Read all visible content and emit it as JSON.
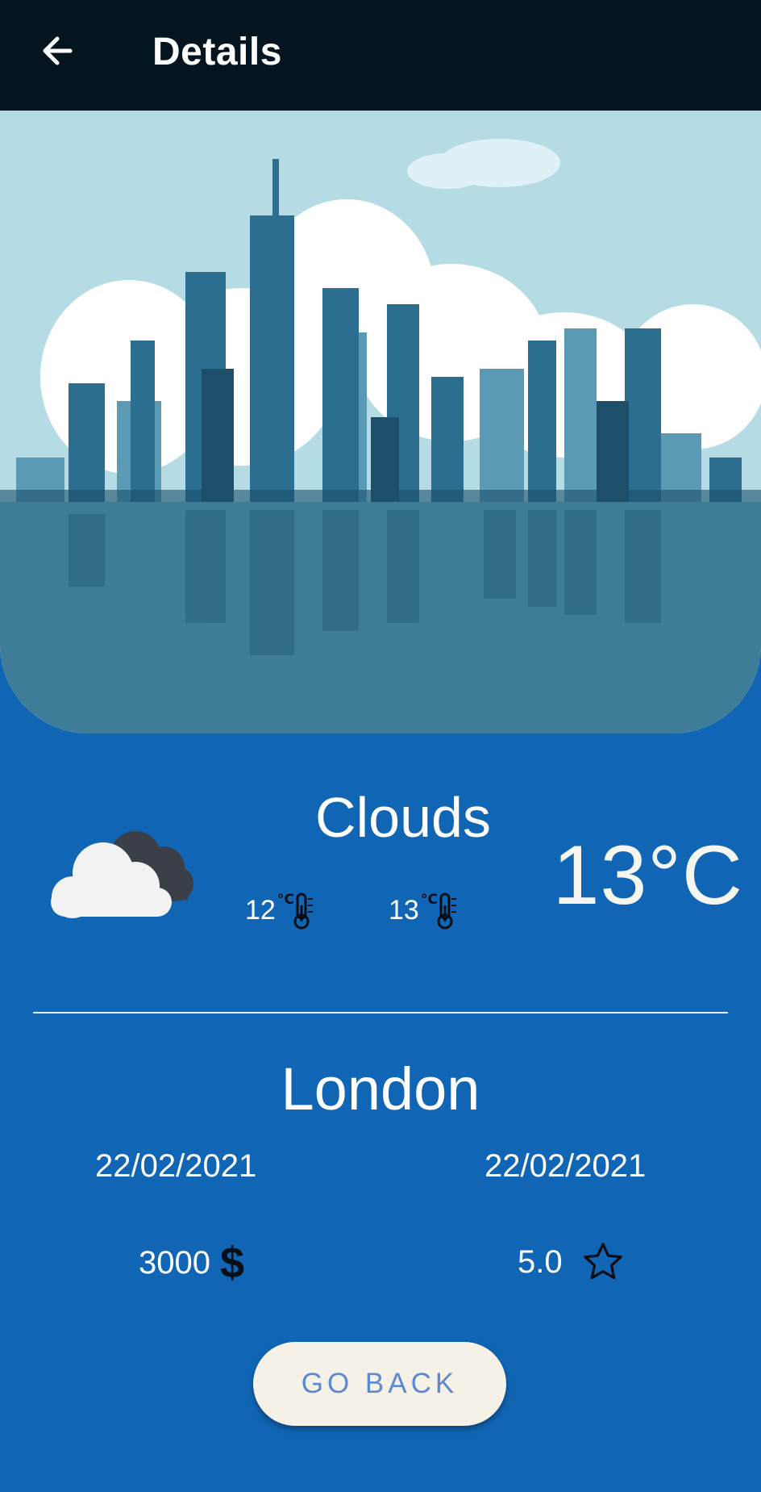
{
  "header": {
    "title": "Details",
    "back_icon": "arrow-left-icon"
  },
  "hero": {
    "image": "city-skyline-illustration"
  },
  "weather": {
    "condition": "Clouds",
    "temperature": "13°C",
    "temp_min": "12",
    "temp_max": "13",
    "icon": "cloud-icon",
    "thermometer_icon": "thermometer-celsius-icon"
  },
  "city": "London",
  "dates": {
    "start": "22/02/2021",
    "end": "22/02/2021"
  },
  "price": {
    "value": "3000",
    "currency_symbol": "$"
  },
  "rating": {
    "value": "5.0",
    "icon": "star-outline-icon"
  },
  "actions": {
    "go_back": "GO BACK"
  },
  "colors": {
    "appbar": "#04151f",
    "background": "#1066b5",
    "button_bg": "#f5f1e7",
    "button_text": "#5d8ad2"
  }
}
